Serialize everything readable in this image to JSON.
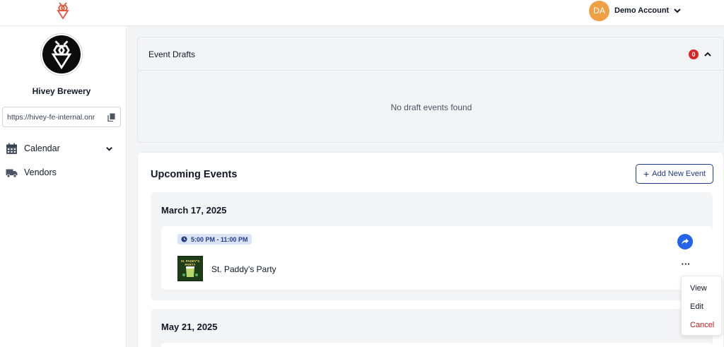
{
  "header": {
    "account": {
      "initials": "DA",
      "name": "Demo Account"
    }
  },
  "sidebar": {
    "brand_name": "Hivey Brewery",
    "url": "https://hivey-fe-internal.onr",
    "nav": [
      {
        "label": "Calendar",
        "icon": "calendar-icon"
      },
      {
        "label": "Vendors",
        "icon": "truck-icon"
      }
    ]
  },
  "drafts": {
    "title": "Event Drafts",
    "count": "0",
    "empty_message": "No draft events found"
  },
  "upcoming": {
    "title": "Upcoming Events",
    "add_button": "Add New Event",
    "groups": [
      {
        "date": "March 17, 2025",
        "events": [
          {
            "time": "5:00 PM - 11:00 PM",
            "name": "St. Paddy's Party",
            "thumb_text": "St. PADDY'S PARTY"
          }
        ]
      },
      {
        "date": "May 21, 2025",
        "events": []
      }
    ]
  },
  "menu": {
    "items": [
      {
        "label": "View"
      },
      {
        "label": "Edit"
      },
      {
        "label": "Cancel"
      }
    ]
  },
  "colors": {
    "accent": "#1e3a8a",
    "share": "#2563eb",
    "danger": "#dc2626",
    "avatar": "#f0a043",
    "brand_logo": "#e0553a"
  }
}
